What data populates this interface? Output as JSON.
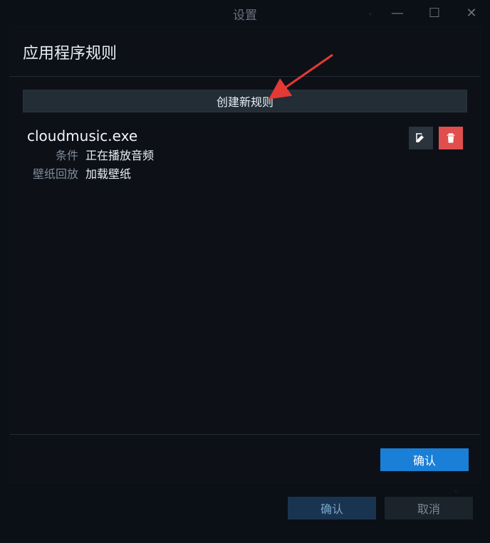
{
  "background_window": {
    "title": "设置",
    "controls": {
      "minimize_icon": "—",
      "maximize_icon": "☐",
      "close_icon": "✕"
    },
    "footer": {
      "confirm_label": "确认",
      "cancel_label": "取消"
    }
  },
  "modal": {
    "title": "应用程序规则",
    "create_rule_label": "创建新规则",
    "rules": [
      {
        "name": "cloudmusic.exe",
        "fields": [
          {
            "key": "条件",
            "value": "正在播放音频"
          },
          {
            "key": "壁纸回放",
            "value": "加载壁纸"
          }
        ],
        "actions": {
          "edit_icon": "edit-icon",
          "delete_icon": "trash-icon"
        }
      }
    ],
    "confirm_label": "确认"
  },
  "colors": {
    "accent": "#1a7fd6",
    "danger": "#e14e4e"
  }
}
